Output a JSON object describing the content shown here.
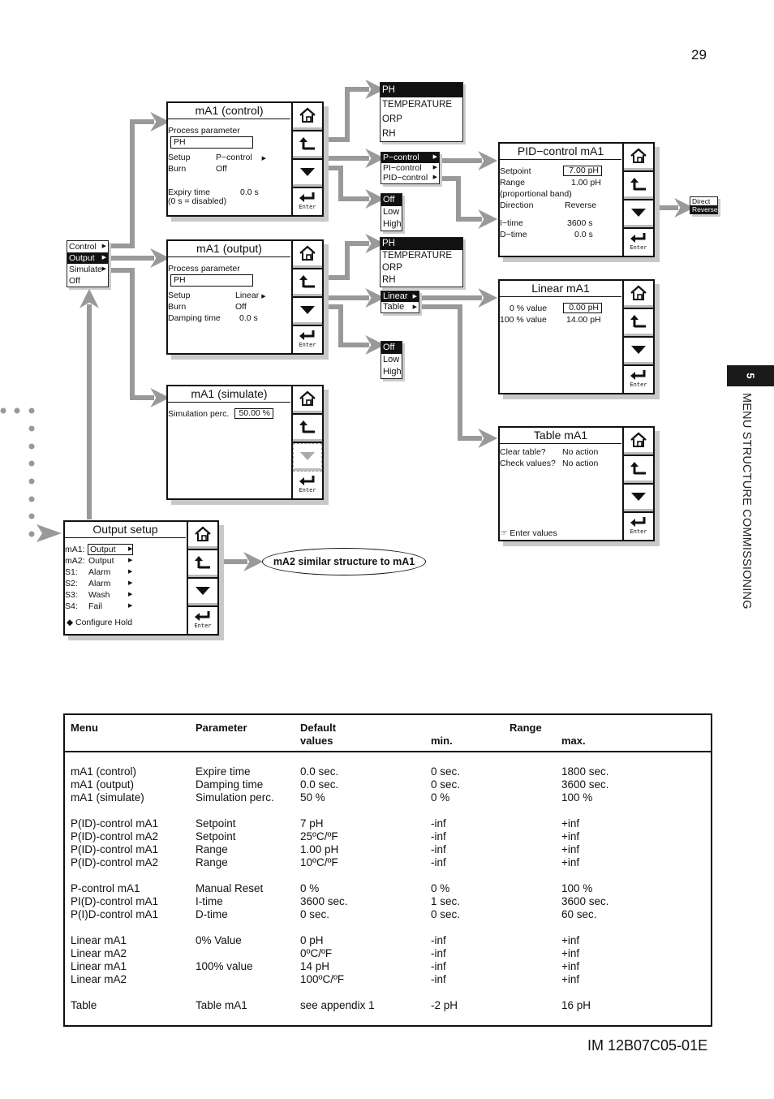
{
  "page_number": "29",
  "doc_id": "IM 12B07C05-01E",
  "side_tab": {
    "chapter": "5",
    "title": "MENU STRUCTURE COMMISSIONING"
  },
  "main_menu": {
    "items": [
      {
        "label": "Control",
        "has_sub": true,
        "selected": false
      },
      {
        "label": "Output",
        "has_sub": true,
        "selected": true
      },
      {
        "label": "Simulate",
        "has_sub": true,
        "selected": false
      },
      {
        "label": "Off",
        "has_sub": false,
        "selected": false
      }
    ]
  },
  "screens": {
    "control": {
      "title": "mA1 (control)",
      "process_label": "Process parameter",
      "process_value": "PH",
      "setup_label": "Setup",
      "setup_value": "P−control",
      "burn_label": "Burn",
      "burn_value": "Off",
      "expiry_label": "Expiry time",
      "expiry_value": "0.0 s",
      "expiry_note": "(0 s = disabled)"
    },
    "output": {
      "title": "mA1 (output)",
      "process_label": "Process parameter",
      "process_value": "PH",
      "setup_label": "Setup",
      "setup_value": "Linear",
      "burn_label": "Burn",
      "burn_value": "Off",
      "damping_label": "Damping time",
      "damping_value": "0.0 s"
    },
    "simulate": {
      "title": "mA1 (simulate)",
      "sim_label": "Simulation perc.",
      "sim_value": "50.00 %"
    },
    "output_setup": {
      "title": "Output setup",
      "rows": [
        {
          "label": "mA1:",
          "value": "Output"
        },
        {
          "label": "mA2:",
          "value": "Output"
        },
        {
          "label": "S1:",
          "value": "Alarm"
        },
        {
          "label": "S2:",
          "value": "Alarm"
        },
        {
          "label": "S3:",
          "value": "Wash"
        },
        {
          "label": "S4:",
          "value": "Fail"
        }
      ],
      "hold_label": "◆ Configure Hold"
    },
    "pid": {
      "title": "PID−control mA1",
      "setpoint_label": "Setpoint",
      "setpoint_value": "7.00 pH",
      "range_label": "Range",
      "range_value": "1.00 pH",
      "range_note": "(proportional band)",
      "direction_label": "Direction",
      "direction_value": "Reverse",
      "itime_label": "I−time",
      "itime_value": "3600 s",
      "dtime_label": "D−time",
      "dtime_value": "0.0 s"
    },
    "linear": {
      "title": "Linear mA1",
      "zero_label": "0 % value",
      "zero_value": "0.00 pH",
      "full_label": "100 % value",
      "full_value": "14.00 pH"
    },
    "table": {
      "title": "Table mA1",
      "clear_label": "Clear table?",
      "clear_value": "No action",
      "check_label": "Check values?",
      "check_value": "No action",
      "enter_label": "☞ Enter values"
    }
  },
  "buttons": {
    "home": "home-icon",
    "back": "back-icon",
    "down": "down-icon",
    "enter": "Enter"
  },
  "popups": {
    "param_ctrl": [
      "PH",
      "TEMPERATURE",
      "ORP",
      "RH"
    ],
    "control_types": [
      "P−control",
      "PI−control",
      "PID−control"
    ],
    "burn_ctrl": [
      "Off",
      "Low",
      "High"
    ],
    "param_out": [
      "PH",
      "TEMPERATURE",
      "ORP",
      "RH"
    ],
    "output_types": [
      "Linear",
      "Table"
    ],
    "burn_out": [
      "Off",
      "Low",
      "High"
    ],
    "direction": [
      "Direct",
      "Reverse"
    ]
  },
  "note": "mA2 similar structure to mA1",
  "table": {
    "headers": {
      "menu": "Menu",
      "parameter": "Parameter",
      "default1": "Default",
      "default2": "values",
      "range": "Range",
      "min": "min.",
      "max": "max."
    },
    "groups": [
      [
        [
          "mA1 (control)",
          "Expire time",
          "0.0 sec.",
          "0 sec.",
          "1800 sec."
        ],
        [
          "mA1 (output)",
          "Damping time",
          "0.0 sec.",
          "0 sec.",
          "3600 sec."
        ],
        [
          "mA1 (simulate)",
          "Simulation perc.",
          "50 %",
          "0 %",
          "100 %"
        ]
      ],
      [
        [
          "P(ID)-control mA1",
          "Setpoint",
          "7 pH",
          "-inf",
          "+inf"
        ],
        [
          "P(ID)-control mA2",
          "Setpoint",
          "25ºC/ºF",
          "-inf",
          "+inf"
        ],
        [
          "P(ID)-control mA1",
          "Range",
          "1.00 pH",
          "-inf",
          "+inf"
        ],
        [
          "P(ID)-control mA2",
          "Range",
          "10ºC/ºF",
          "-inf",
          "+inf"
        ]
      ],
      [
        [
          "P-control mA1",
          "Manual Reset",
          "0 %",
          "0 %",
          "100 %"
        ],
        [
          "PI(D)-control mA1",
          "I-time",
          "3600 sec.",
          "1 sec.",
          "3600 sec."
        ],
        [
          "P(I)D-control mA1",
          "D-time",
          "0 sec.",
          "0 sec.",
          "60 sec."
        ]
      ],
      [
        [
          "Linear mA1",
          "0% Value",
          "0 pH",
          "-inf",
          "+inf"
        ],
        [
          "Linear mA2",
          "",
          "0ºC/ºF",
          "-inf",
          "+inf"
        ],
        [
          "Linear mA1",
          "100% value",
          "14 pH",
          "-inf",
          "+inf"
        ],
        [
          "Linear mA2",
          "",
          "100ºC/ºF",
          "-inf",
          "+inf"
        ]
      ],
      [
        [
          "Table",
          "Table mA1",
          "see appendix 1",
          "-2 pH",
          "16 pH"
        ]
      ]
    ]
  }
}
